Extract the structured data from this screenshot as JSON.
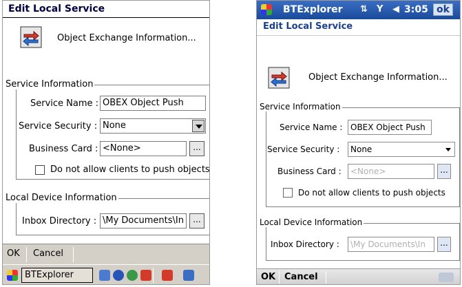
{
  "left": {
    "title": "Edit Local Service",
    "header_text": "Object Exchange Information...",
    "service_group": "Service Information",
    "service_name_label": "Service Name :",
    "service_name_value": "OBEX Object Push",
    "service_security_label": "Service Security :",
    "service_security_value": "None",
    "business_card_label": "Business Card :",
    "business_card_value": "<None>",
    "ellipsis": "...",
    "checkbox_label": "Do not allow clients to push objects",
    "device_group": "Local Device Information",
    "inbox_label": "Inbox Directory :",
    "inbox_value": "\\My Documents\\In",
    "menu_ok": "OK",
    "menu_cancel": "Cancel",
    "taskbar_app": "BTExplorer"
  },
  "right": {
    "app_title": "BTExplorer",
    "time": "3:05",
    "ok_button": "ok",
    "title": "Edit Local Service",
    "header_text": "Object Exchange Information...",
    "service_group": "Service Information",
    "service_name_label": "Service Name :",
    "service_name_value": "OBEX Object Push",
    "service_security_label": "Service Security :",
    "service_security_value": "None",
    "business_card_label": "Business Card :",
    "business_card_value": "<None>",
    "ellipsis": "...",
    "checkbox_label": "Do not allow clients to push objects",
    "device_group": "Local Device Information",
    "inbox_label": "Inbox Directory :",
    "inbox_value": "\\My Documents\\In",
    "menu_ok": "OK",
    "menu_cancel": "Cancel"
  },
  "colors": {
    "wm_titlebar": "#1a4a9a",
    "classic_bar": "#d4d0c8",
    "title_blue": "#1a3f8c"
  }
}
